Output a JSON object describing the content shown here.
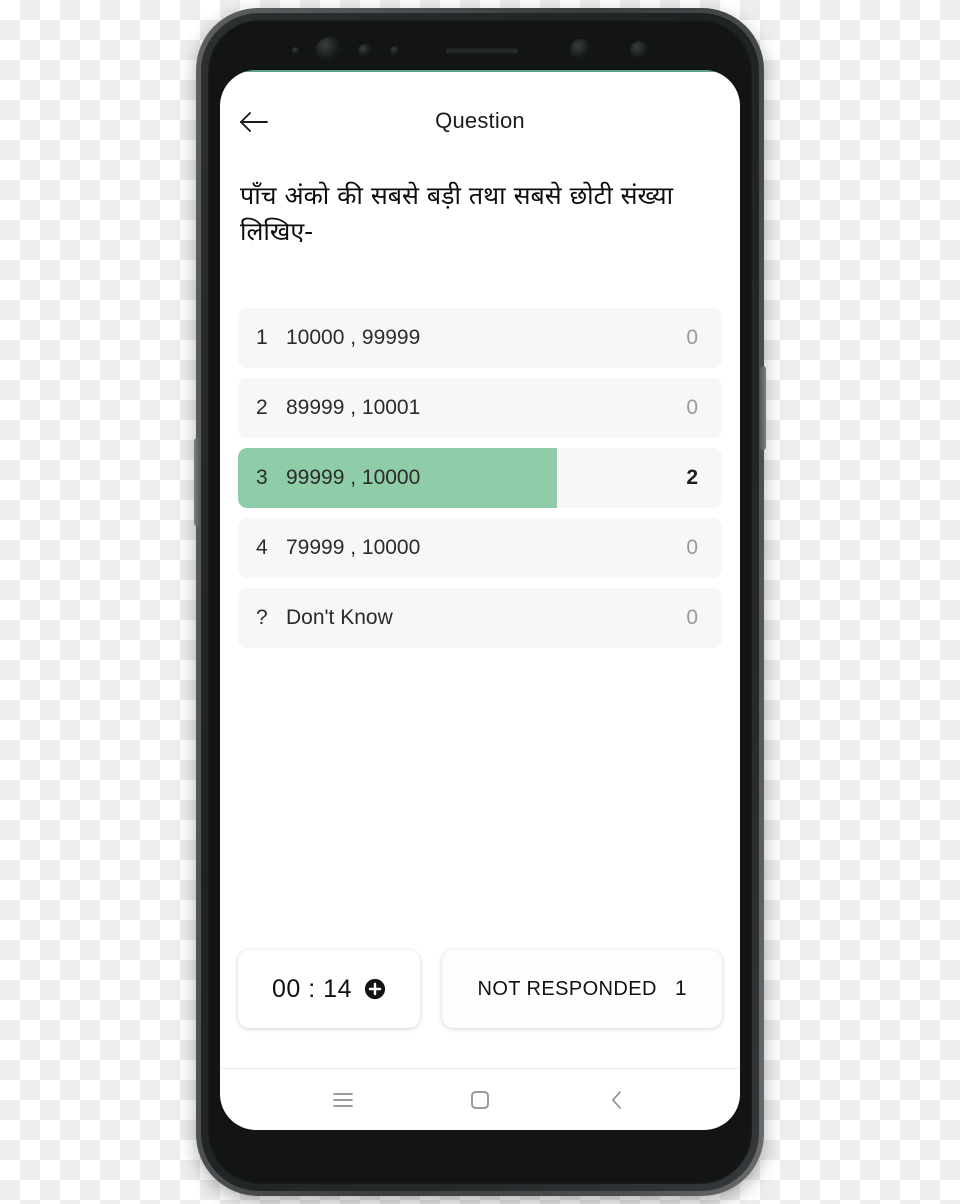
{
  "header": {
    "title": "Question",
    "back_icon": "arrow-left-icon"
  },
  "question": {
    "text": "पाँच अंको की सबसे बड़ी तथा सबसे छोटी संख्या लिखिए-"
  },
  "options": [
    {
      "index": "1",
      "label": "10000 , 99999",
      "count": "0",
      "fill_percent": 0,
      "selected": false
    },
    {
      "index": "2",
      "label": "89999 , 10001",
      "count": "0",
      "fill_percent": 0,
      "selected": false
    },
    {
      "index": "3",
      "label": "99999 , 10000",
      "count": "2",
      "fill_percent": 66,
      "selected": true
    },
    {
      "index": "4",
      "label": "79999 , 10000",
      "count": "0",
      "fill_percent": 0,
      "selected": false
    },
    {
      "index": "?",
      "label": "Don't Know",
      "count": "0",
      "fill_percent": 0,
      "selected": false
    }
  ],
  "bottom": {
    "timer": "00 : 14",
    "add_time_icon": "plus-circle-icon",
    "status_label": "NOT RESPONDED",
    "status_count": "1"
  },
  "navbar": {
    "recents_icon": "menu-icon",
    "home_icon": "square-icon",
    "back_icon": "chevron-left-icon"
  },
  "colors": {
    "highlight_green": "#8fcca8",
    "row_background": "#f7f7f7",
    "screen_top_tint": "#3f8f72"
  }
}
